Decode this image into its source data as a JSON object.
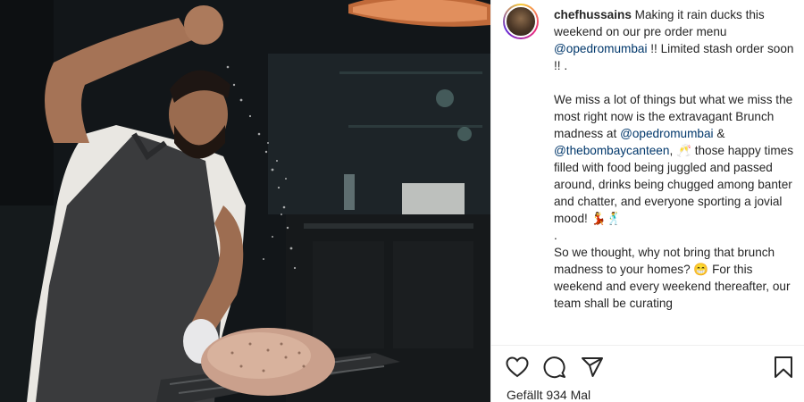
{
  "post": {
    "username": "chefhussains",
    "caption_lines": [
      "Making it rain ducks this weekend on our pre order menu"
    ],
    "mentions": {
      "opedro_1": "@opedromumbai",
      "opedro_2": "@opedromumbai",
      "bombaycanteen": "@thebombaycanteen"
    },
    "text": {
      "intro_after": " !! Limited stash order soon !! .",
      "para2_a": "We miss a lot of things but what we miss the most right now is the extravagant Brunch madness at ",
      "para2_b": " & ",
      "para2_c": ", 🥂 those happy times filled with food being juggled and passed around, drinks being chugged among banter and chatter, and everyone sporting a jovial mood! 💃🕺",
      "dot": ".",
      "para3": "So we thought, why not bring that brunch madness to your homes? 😁 For this weekend and every weekend thereafter, our team shall be curating"
    }
  },
  "actions": {
    "like_icon": "heart-icon",
    "comment_icon": "comment-icon",
    "share_icon": "paper-plane-icon",
    "save_icon": "bookmark-icon"
  },
  "likes_text": "Gefällt 934 Mal",
  "colors": {
    "mention": "#00376b",
    "text": "#262626",
    "border": "#efefef"
  }
}
